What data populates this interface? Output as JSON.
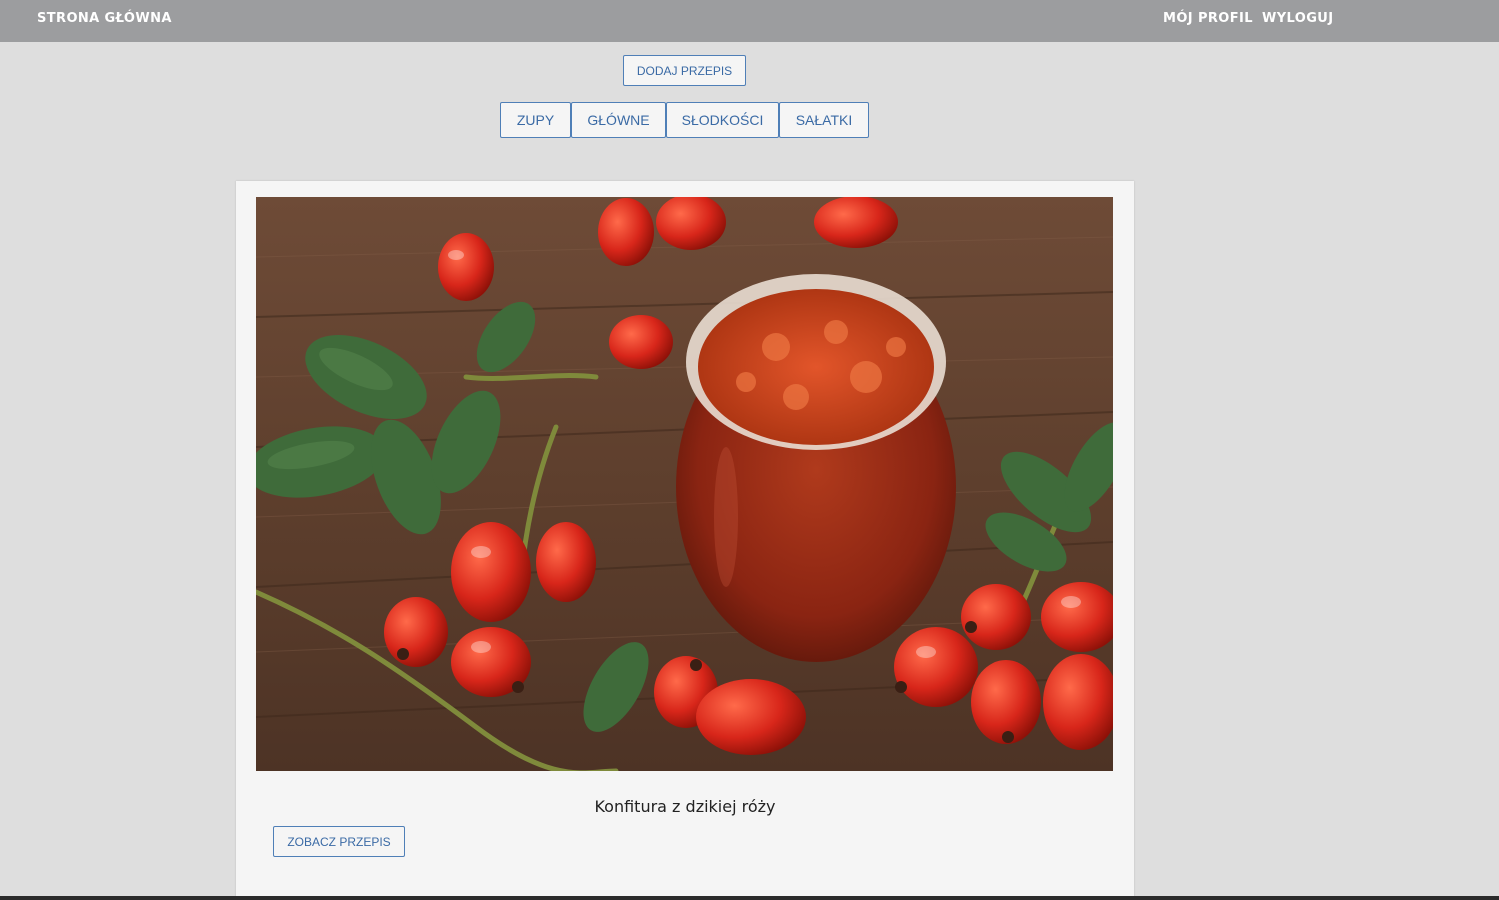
{
  "header": {
    "home_label": "STRONA GŁÓWNA",
    "profile_label": "MÓJ PROFIL",
    "logout_label": "WYLOGUJ"
  },
  "actions": {
    "add_recipe_label": "DODAJ PRZEPIS"
  },
  "categories": [
    {
      "label": "ZUPY"
    },
    {
      "label": "GŁÓWNE"
    },
    {
      "label": "SŁODKOŚCI"
    },
    {
      "label": "SAŁATKI"
    }
  ],
  "recipes": [
    {
      "title": "Konfitura z dzikiej róży",
      "view_label": "ZOBACZ PRZEPIS"
    }
  ],
  "colors": {
    "topbar": "#9c9d9f",
    "page_background": "#dedede",
    "card_background": "#f5f5f5",
    "button_border": "#4f7fb7",
    "button_text": "#3a6aa5"
  }
}
